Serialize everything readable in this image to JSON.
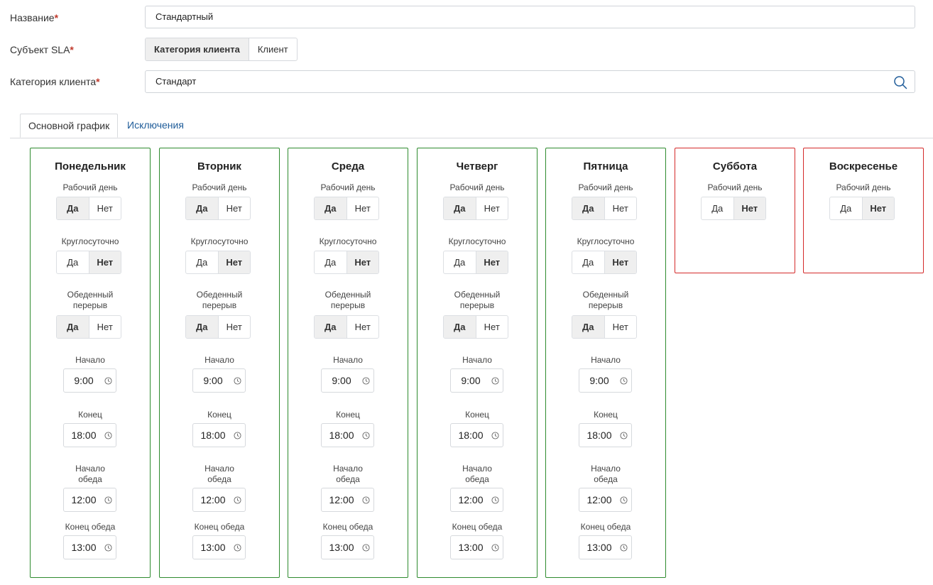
{
  "form": {
    "name_label": "Название",
    "name_value": "Стандартный",
    "subject_label": "Субъект SLA",
    "subject_options": [
      "Категория клиента",
      "Клиент"
    ],
    "category_label": "Категория клиента",
    "category_value": "Стандарт",
    "required_mark": "*"
  },
  "tabs": [
    "Основной график",
    "Исключения"
  ],
  "labels": {
    "working_day": "Рабочий день",
    "round_clock": "Круглосуточно",
    "lunch_break_1": "Обеденный",
    "lunch_break_2": "перерыв",
    "start": "Начало",
    "end": "Конец",
    "lunch_start_1": "Начало",
    "lunch_start_2": "обеда",
    "lunch_end": "Конец обеда",
    "yes": "Да",
    "no": "Нет"
  },
  "days": [
    {
      "name": "Понедельник",
      "working": true,
      "round_clock": false,
      "lunch": true,
      "start": "9:00",
      "end": "18:00",
      "lunch_start": "12:00",
      "lunch_end": "13:00"
    },
    {
      "name": "Вторник",
      "working": true,
      "round_clock": false,
      "lunch": true,
      "start": "9:00",
      "end": "18:00",
      "lunch_start": "12:00",
      "lunch_end": "13:00"
    },
    {
      "name": "Среда",
      "working": true,
      "round_clock": false,
      "lunch": true,
      "start": "9:00",
      "end": "18:00",
      "lunch_start": "12:00",
      "lunch_end": "13:00"
    },
    {
      "name": "Четверг",
      "working": true,
      "round_clock": false,
      "lunch": true,
      "start": "9:00",
      "end": "18:00",
      "lunch_start": "12:00",
      "lunch_end": "13:00"
    },
    {
      "name": "Пятница",
      "working": true,
      "round_clock": false,
      "lunch": true,
      "start": "9:00",
      "end": "18:00",
      "lunch_start": "12:00",
      "lunch_end": "13:00"
    },
    {
      "name": "Суббота",
      "working": false
    },
    {
      "name": "Воскресенье",
      "working": false
    }
  ],
  "colors": {
    "working_border": "#2e8b2e",
    "off_border": "#d42a2a",
    "required": "#c0392b",
    "link": "#1f5c99"
  }
}
